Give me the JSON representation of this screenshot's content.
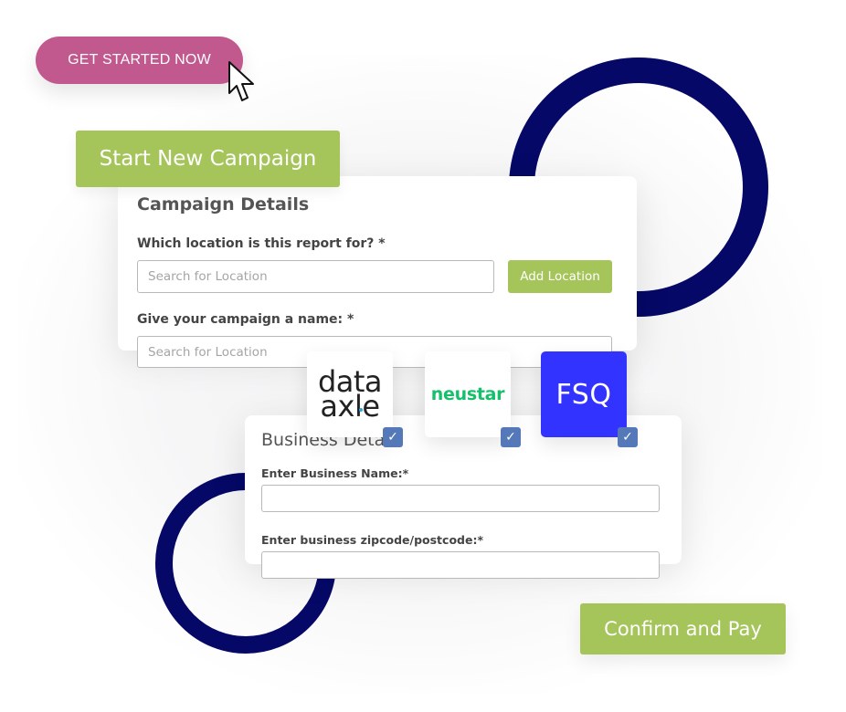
{
  "hero": {
    "get_started_label": "GET STARTED NOW",
    "start_campaign_label": "Start New Campaign",
    "confirm_label": "Confirm and Pay"
  },
  "campaign_card": {
    "title": "Campaign Details",
    "location_label": "Which location is this report for? *",
    "location_placeholder": "Search for Location",
    "add_location_label": "Add Location",
    "name_label": "Give your campaign a name: *",
    "name_placeholder": "Search for Location"
  },
  "providers": [
    {
      "name": "data axle",
      "line1": "data",
      "line2": "axle",
      "checked": true,
      "accent": "#2fa8e0"
    },
    {
      "name": "neustar",
      "label": "neustar",
      "checked": true,
      "color": "#16c06b"
    },
    {
      "name": "FSQ",
      "label": "FSQ",
      "checked": true,
      "color": "#3333ff"
    }
  ],
  "checkbox_glyph": "✓",
  "business_card": {
    "title": "Business Deta",
    "business_name_label": "Enter Business Name:*",
    "business_name_value": "",
    "zipcode_label": "Enter business zipcode/postcode:*",
    "zipcode_value": ""
  },
  "colors": {
    "pink": "#c1588e",
    "green": "#a5c45a",
    "navy": "#050866",
    "checkbox_blue": "#5579b8"
  }
}
